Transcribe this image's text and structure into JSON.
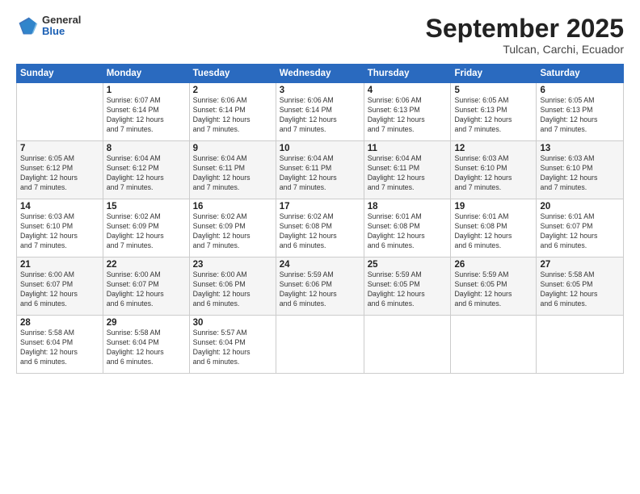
{
  "header": {
    "logo": {
      "general": "General",
      "blue": "Blue"
    },
    "title": "September 2025",
    "subtitle": "Tulcan, Carchi, Ecuador"
  },
  "calendar": {
    "days_of_week": [
      "Sunday",
      "Monday",
      "Tuesday",
      "Wednesday",
      "Thursday",
      "Friday",
      "Saturday"
    ],
    "weeks": [
      [
        {
          "day": "",
          "info": ""
        },
        {
          "day": "1",
          "info": "Sunrise: 6:07 AM\nSunset: 6:14 PM\nDaylight: 12 hours\nand 7 minutes."
        },
        {
          "day": "2",
          "info": "Sunrise: 6:06 AM\nSunset: 6:14 PM\nDaylight: 12 hours\nand 7 minutes."
        },
        {
          "day": "3",
          "info": "Sunrise: 6:06 AM\nSunset: 6:14 PM\nDaylight: 12 hours\nand 7 minutes."
        },
        {
          "day": "4",
          "info": "Sunrise: 6:06 AM\nSunset: 6:13 PM\nDaylight: 12 hours\nand 7 minutes."
        },
        {
          "day": "5",
          "info": "Sunrise: 6:05 AM\nSunset: 6:13 PM\nDaylight: 12 hours\nand 7 minutes."
        },
        {
          "day": "6",
          "info": "Sunrise: 6:05 AM\nSunset: 6:13 PM\nDaylight: 12 hours\nand 7 minutes."
        }
      ],
      [
        {
          "day": "7",
          "info": "Sunrise: 6:05 AM\nSunset: 6:12 PM\nDaylight: 12 hours\nand 7 minutes."
        },
        {
          "day": "8",
          "info": "Sunrise: 6:04 AM\nSunset: 6:12 PM\nDaylight: 12 hours\nand 7 minutes."
        },
        {
          "day": "9",
          "info": "Sunrise: 6:04 AM\nSunset: 6:11 PM\nDaylight: 12 hours\nand 7 minutes."
        },
        {
          "day": "10",
          "info": "Sunrise: 6:04 AM\nSunset: 6:11 PM\nDaylight: 12 hours\nand 7 minutes."
        },
        {
          "day": "11",
          "info": "Sunrise: 6:04 AM\nSunset: 6:11 PM\nDaylight: 12 hours\nand 7 minutes."
        },
        {
          "day": "12",
          "info": "Sunrise: 6:03 AM\nSunset: 6:10 PM\nDaylight: 12 hours\nand 7 minutes."
        },
        {
          "day": "13",
          "info": "Sunrise: 6:03 AM\nSunset: 6:10 PM\nDaylight: 12 hours\nand 7 minutes."
        }
      ],
      [
        {
          "day": "14",
          "info": "Sunrise: 6:03 AM\nSunset: 6:10 PM\nDaylight: 12 hours\nand 7 minutes."
        },
        {
          "day": "15",
          "info": "Sunrise: 6:02 AM\nSunset: 6:09 PM\nDaylight: 12 hours\nand 7 minutes."
        },
        {
          "day": "16",
          "info": "Sunrise: 6:02 AM\nSunset: 6:09 PM\nDaylight: 12 hours\nand 7 minutes."
        },
        {
          "day": "17",
          "info": "Sunrise: 6:02 AM\nSunset: 6:08 PM\nDaylight: 12 hours\nand 6 minutes."
        },
        {
          "day": "18",
          "info": "Sunrise: 6:01 AM\nSunset: 6:08 PM\nDaylight: 12 hours\nand 6 minutes."
        },
        {
          "day": "19",
          "info": "Sunrise: 6:01 AM\nSunset: 6:08 PM\nDaylight: 12 hours\nand 6 minutes."
        },
        {
          "day": "20",
          "info": "Sunrise: 6:01 AM\nSunset: 6:07 PM\nDaylight: 12 hours\nand 6 minutes."
        }
      ],
      [
        {
          "day": "21",
          "info": "Sunrise: 6:00 AM\nSunset: 6:07 PM\nDaylight: 12 hours\nand 6 minutes."
        },
        {
          "day": "22",
          "info": "Sunrise: 6:00 AM\nSunset: 6:07 PM\nDaylight: 12 hours\nand 6 minutes."
        },
        {
          "day": "23",
          "info": "Sunrise: 6:00 AM\nSunset: 6:06 PM\nDaylight: 12 hours\nand 6 minutes."
        },
        {
          "day": "24",
          "info": "Sunrise: 5:59 AM\nSunset: 6:06 PM\nDaylight: 12 hours\nand 6 minutes."
        },
        {
          "day": "25",
          "info": "Sunrise: 5:59 AM\nSunset: 6:05 PM\nDaylight: 12 hours\nand 6 minutes."
        },
        {
          "day": "26",
          "info": "Sunrise: 5:59 AM\nSunset: 6:05 PM\nDaylight: 12 hours\nand 6 minutes."
        },
        {
          "day": "27",
          "info": "Sunrise: 5:58 AM\nSunset: 6:05 PM\nDaylight: 12 hours\nand 6 minutes."
        }
      ],
      [
        {
          "day": "28",
          "info": "Sunrise: 5:58 AM\nSunset: 6:04 PM\nDaylight: 12 hours\nand 6 minutes."
        },
        {
          "day": "29",
          "info": "Sunrise: 5:58 AM\nSunset: 6:04 PM\nDaylight: 12 hours\nand 6 minutes."
        },
        {
          "day": "30",
          "info": "Sunrise: 5:57 AM\nSunset: 6:04 PM\nDaylight: 12 hours\nand 6 minutes."
        },
        {
          "day": "",
          "info": ""
        },
        {
          "day": "",
          "info": ""
        },
        {
          "day": "",
          "info": ""
        },
        {
          "day": "",
          "info": ""
        }
      ]
    ]
  }
}
